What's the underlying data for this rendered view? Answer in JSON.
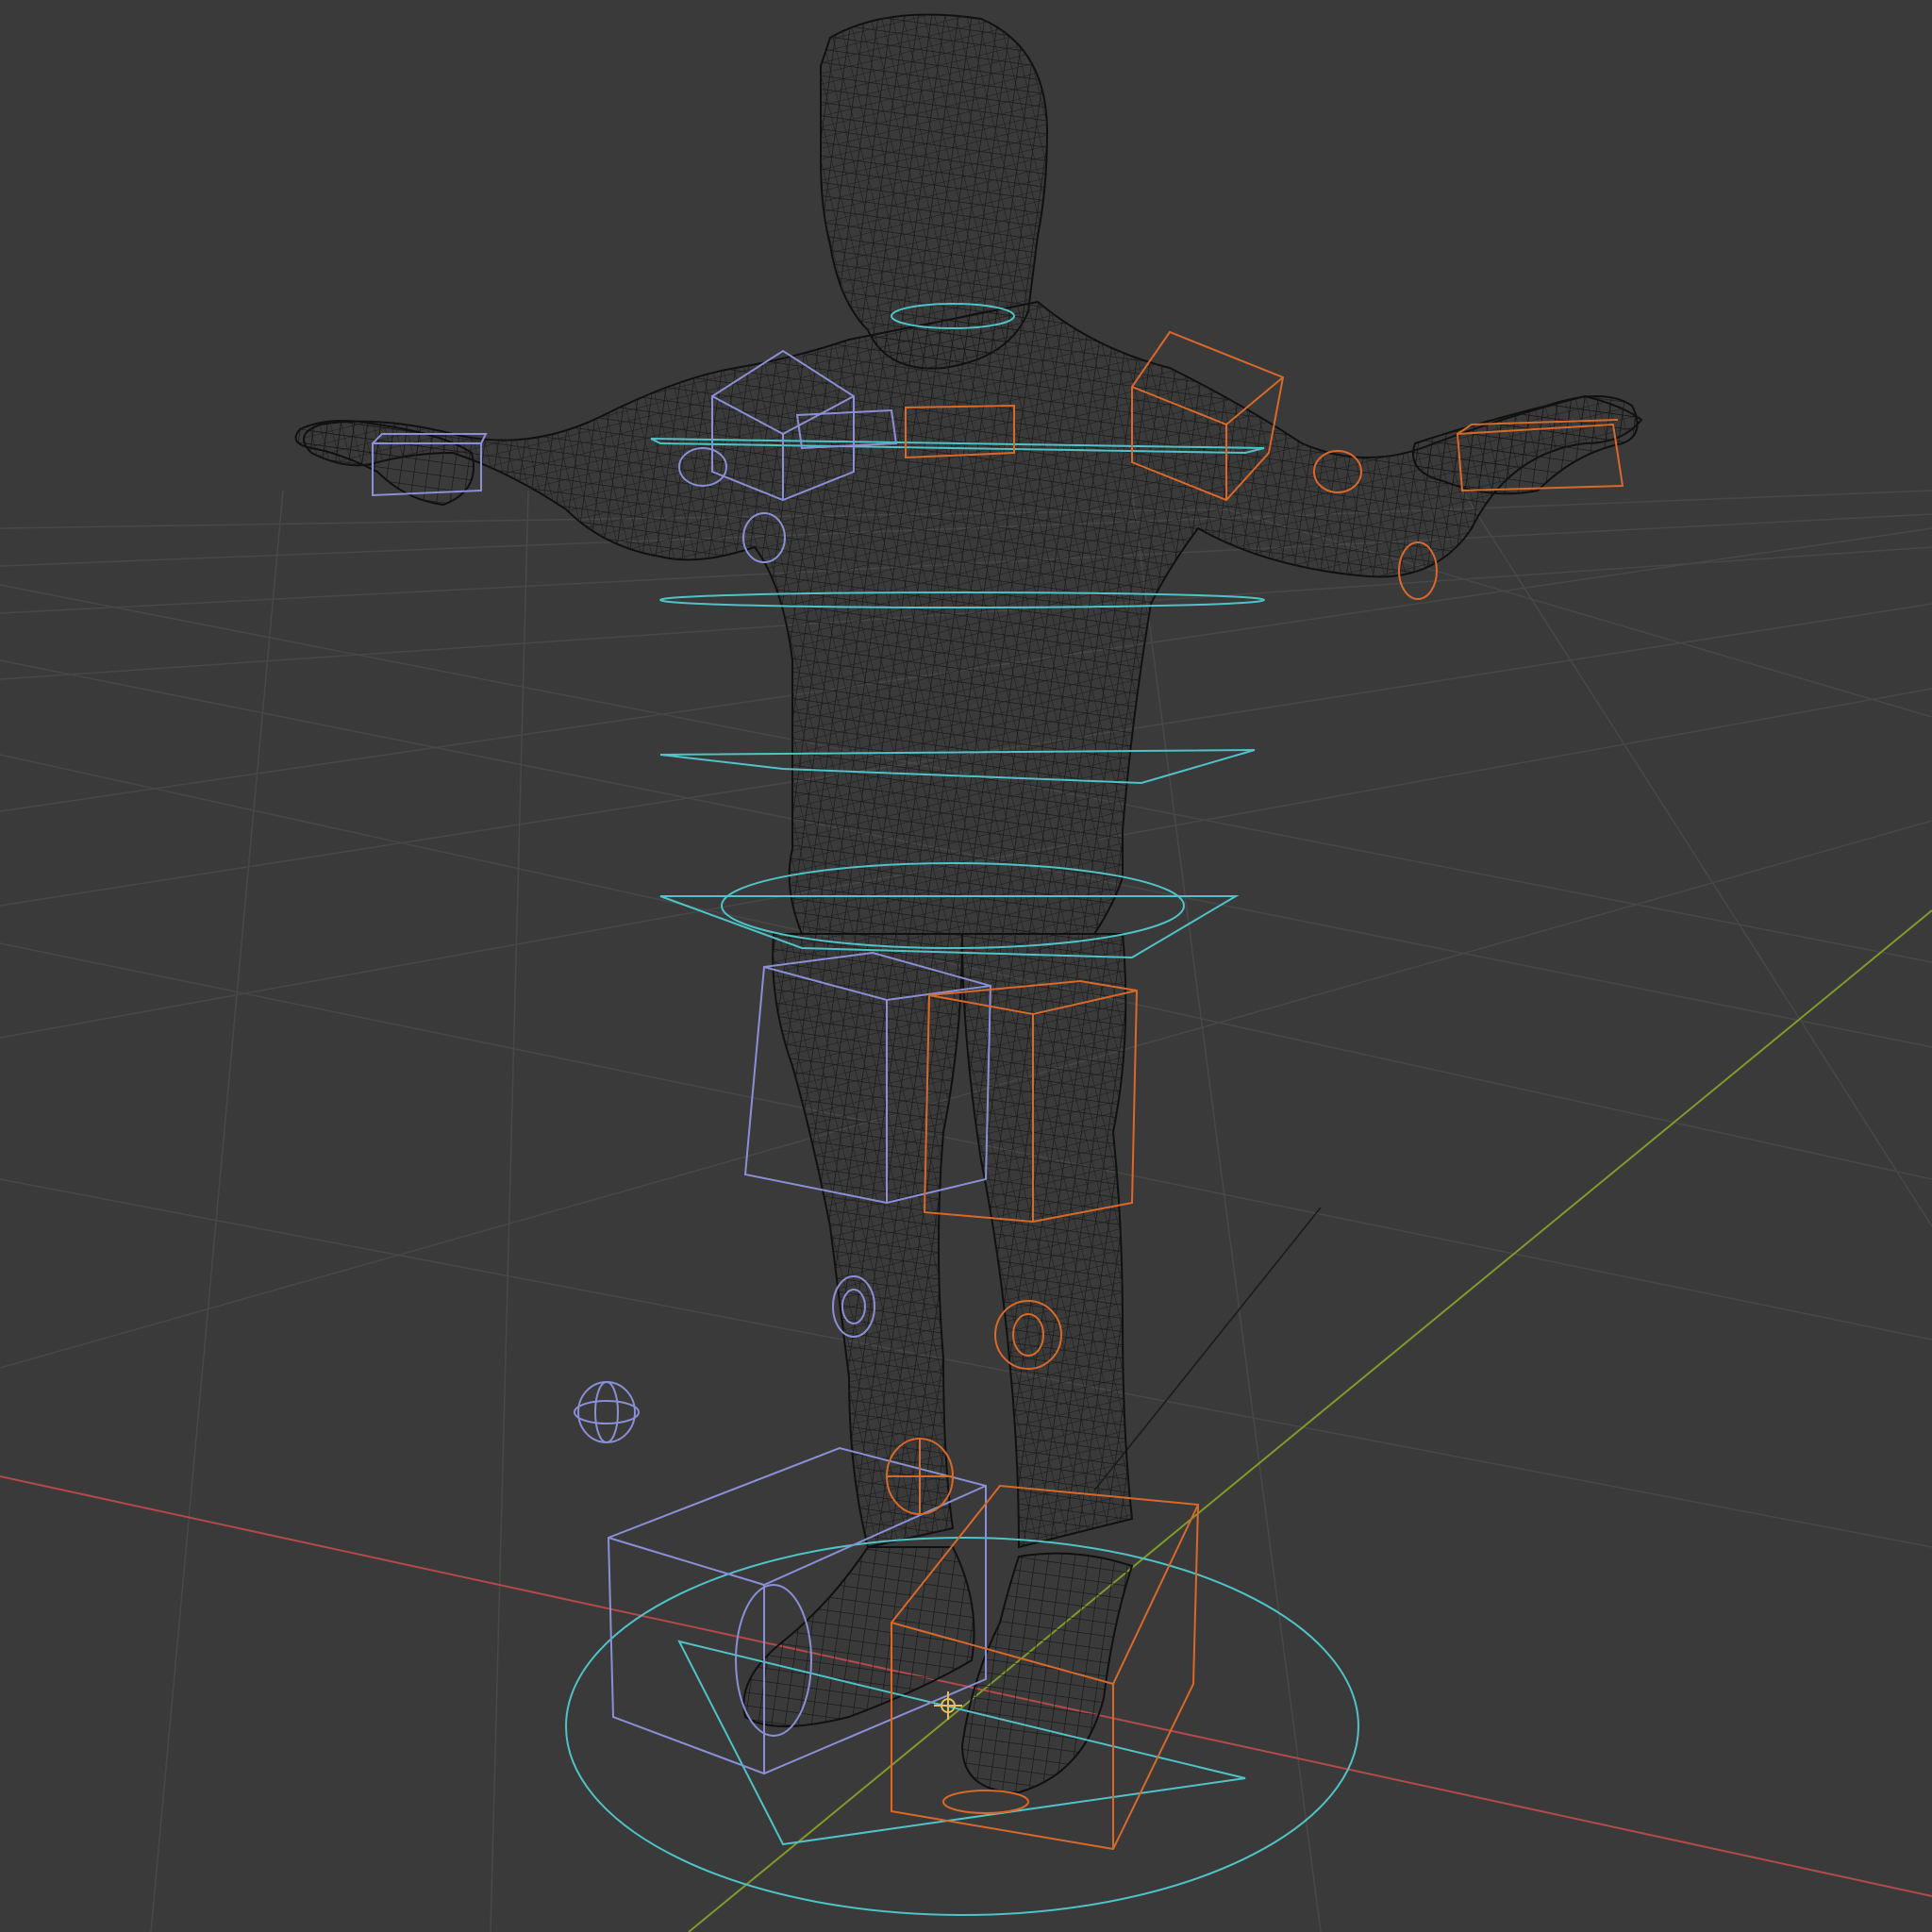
{
  "viewport": {
    "shading_mode": "wireframe",
    "view": "perspective",
    "background_color": "#3a3a3a",
    "grid_color": "#4a4a4a",
    "x_axis_color": "#b34a4a",
    "y_axis_color": "#7f9a2a"
  },
  "scene": {
    "mesh_object": "humanoid-character-tpose",
    "mesh_wire_color": "#111111",
    "armature": "rig",
    "control_colors": {
      "center": "#4fc3c7",
      "left_side": "#8a8fd6",
      "right_side": "#d9692a"
    },
    "icons": [
      "3d-cursor-icon",
      "empty-sphere-icon"
    ]
  }
}
